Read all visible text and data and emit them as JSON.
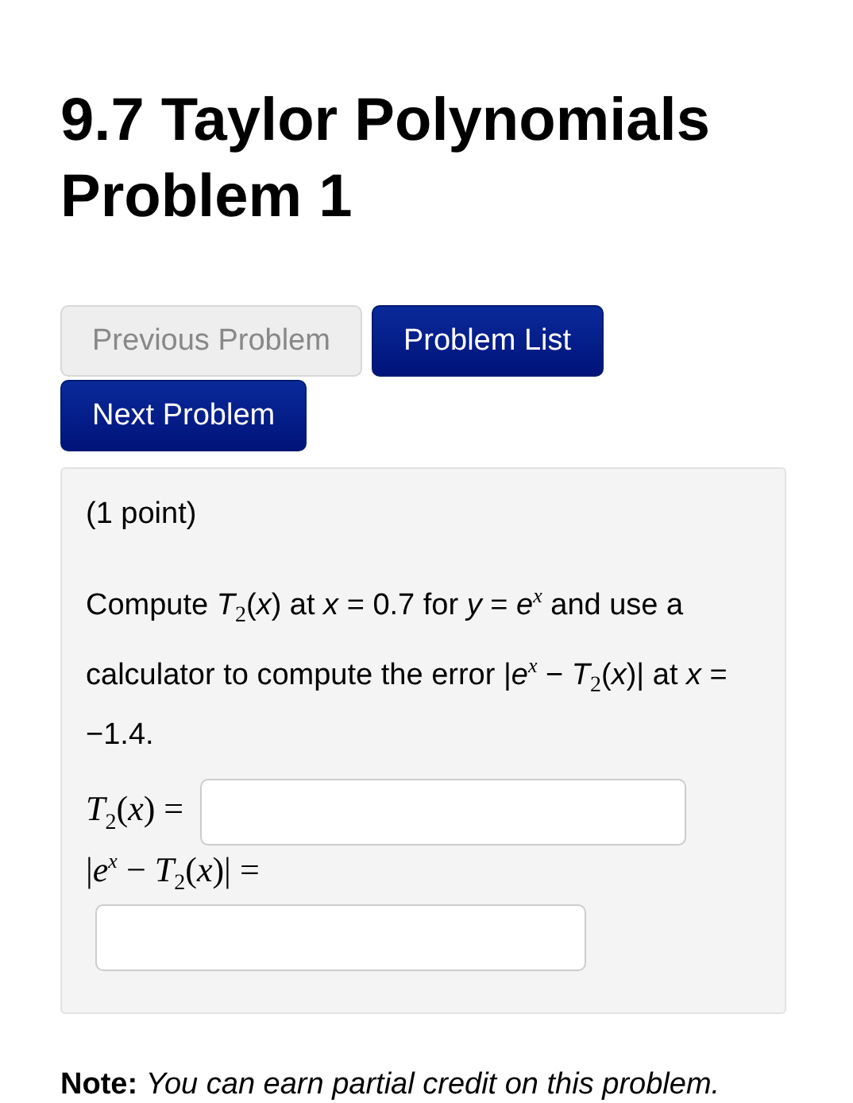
{
  "title": {
    "lines": [
      "9.7 Taylor Polynomials",
      "Problem 1"
    ]
  },
  "nav_buttons": [
    {
      "label": "Previous Problem",
      "disabled": true
    },
    {
      "label": "Problem List",
      "disabled": false
    },
    {
      "label": "Next Problem",
      "disabled": false
    }
  ],
  "problem": {
    "points": "(1 point)",
    "question": "Compute *T*$_{2}$(*x*) at *x* = 0.7 for *y* = *e*$^{x}$ and use a calculator to compute the error |*e*$^{x}$ − *T*$_{2}$(*x*)| at *x* = −1.4.",
    "answers": [
      {
        "label": "*T*$_{2}$(*x*) =",
        "kind": "inline"
      },
      {
        "label": "|*e*$^{x}$ − *T*$_{2}$(*x*)| =",
        "kind": "below"
      }
    ]
  },
  "note": {
    "label": "Note:",
    "text": "You can earn partial credit on this problem."
  }
}
